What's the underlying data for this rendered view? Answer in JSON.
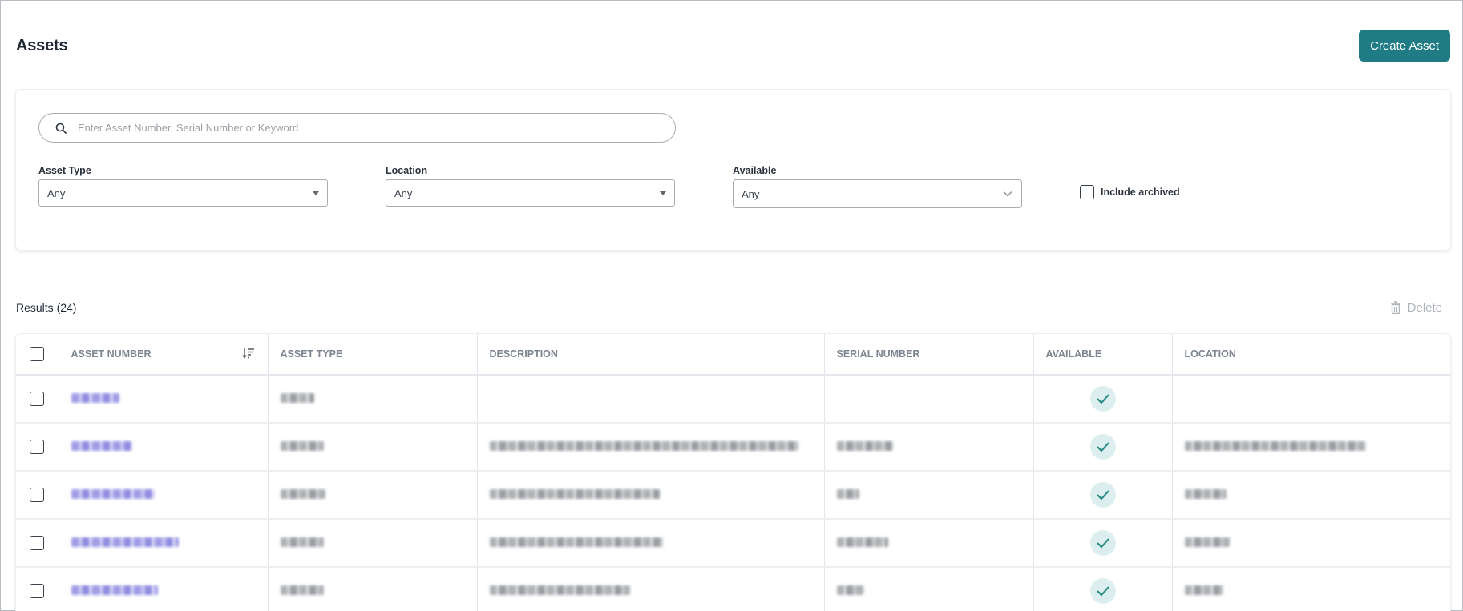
{
  "header": {
    "title": "Assets",
    "create_button": "Create Asset"
  },
  "filters": {
    "search_placeholder": "Enter Asset Number, Serial Number or Keyword",
    "asset_type": {
      "label": "Asset Type",
      "value": "Any"
    },
    "location": {
      "label": "Location",
      "value": "Any"
    },
    "available": {
      "label": "Available",
      "value": "Any"
    },
    "include_archived": {
      "label": "Include archived",
      "checked": false
    }
  },
  "results": {
    "label": "Results (24)",
    "delete_label": "Delete"
  },
  "table": {
    "columns": [
      "ASSET NUMBER",
      "ASSET TYPE",
      "DESCRIPTION",
      "SERIAL NUMBER",
      "AVAILABLE",
      "LOCATION"
    ],
    "rows": [
      {
        "available": true
      },
      {
        "available": true
      },
      {
        "available": true
      },
      {
        "available": true
      },
      {
        "available": true
      }
    ]
  },
  "colors": {
    "accent": "#1f7c85",
    "available_badge": "#dcefee",
    "check": "#1f8a80"
  }
}
